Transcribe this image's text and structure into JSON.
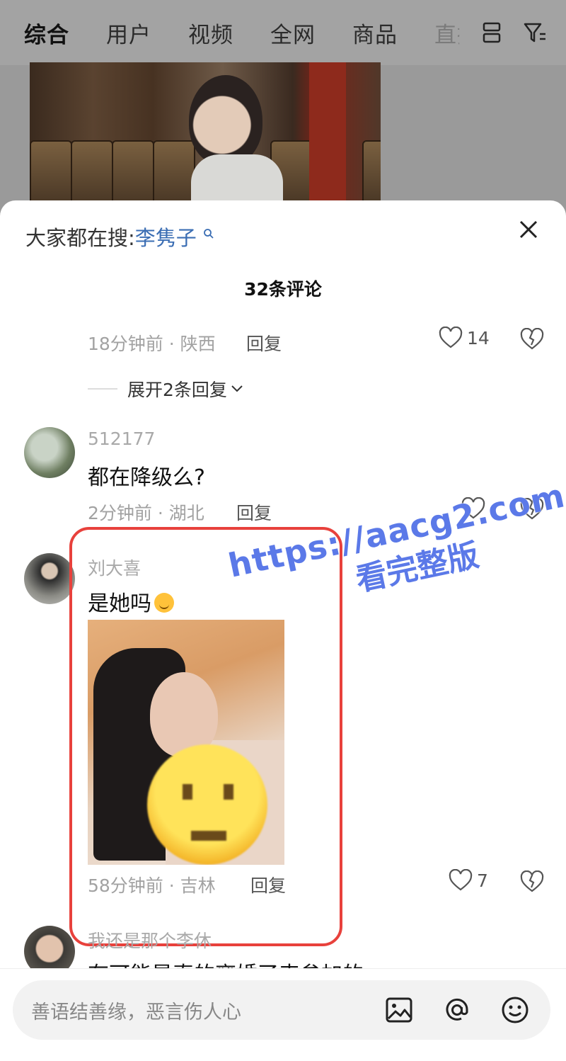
{
  "top_tabs": [
    "综合",
    "用户",
    "视频",
    "全网",
    "商品",
    "直播"
  ],
  "panel": {
    "search_prefix": "大家都在搜:",
    "search_keyword": "李隽子",
    "comment_count_title": "32条评论"
  },
  "comment_top": {
    "time_location": "18分钟前 · 陕西",
    "reply_label": "回复",
    "likes": "14"
  },
  "expand_label": "展开2条回复",
  "comments": [
    {
      "username": "512177",
      "text": "都在降级么?",
      "time_location": "2分钟前 · 湖北",
      "reply_label": "回复",
      "likes": ""
    },
    {
      "username": "刘大喜",
      "text": "是她吗",
      "time_location": "58分钟前 · 吉林",
      "reply_label": "回复",
      "likes": "7"
    },
    {
      "username": "我还是那个李休",
      "text": "有可能是真的离婚了来参加的"
    }
  ],
  "watermark": {
    "line1": "https://aacg2.com",
    "line2": "看完整版"
  },
  "input_placeholder": "善语结善缘，恶言伤人心",
  "colors": {
    "highlight_box": "#e8413c",
    "keyword": "#3a6db3",
    "watermark": "#5b79e8"
  }
}
